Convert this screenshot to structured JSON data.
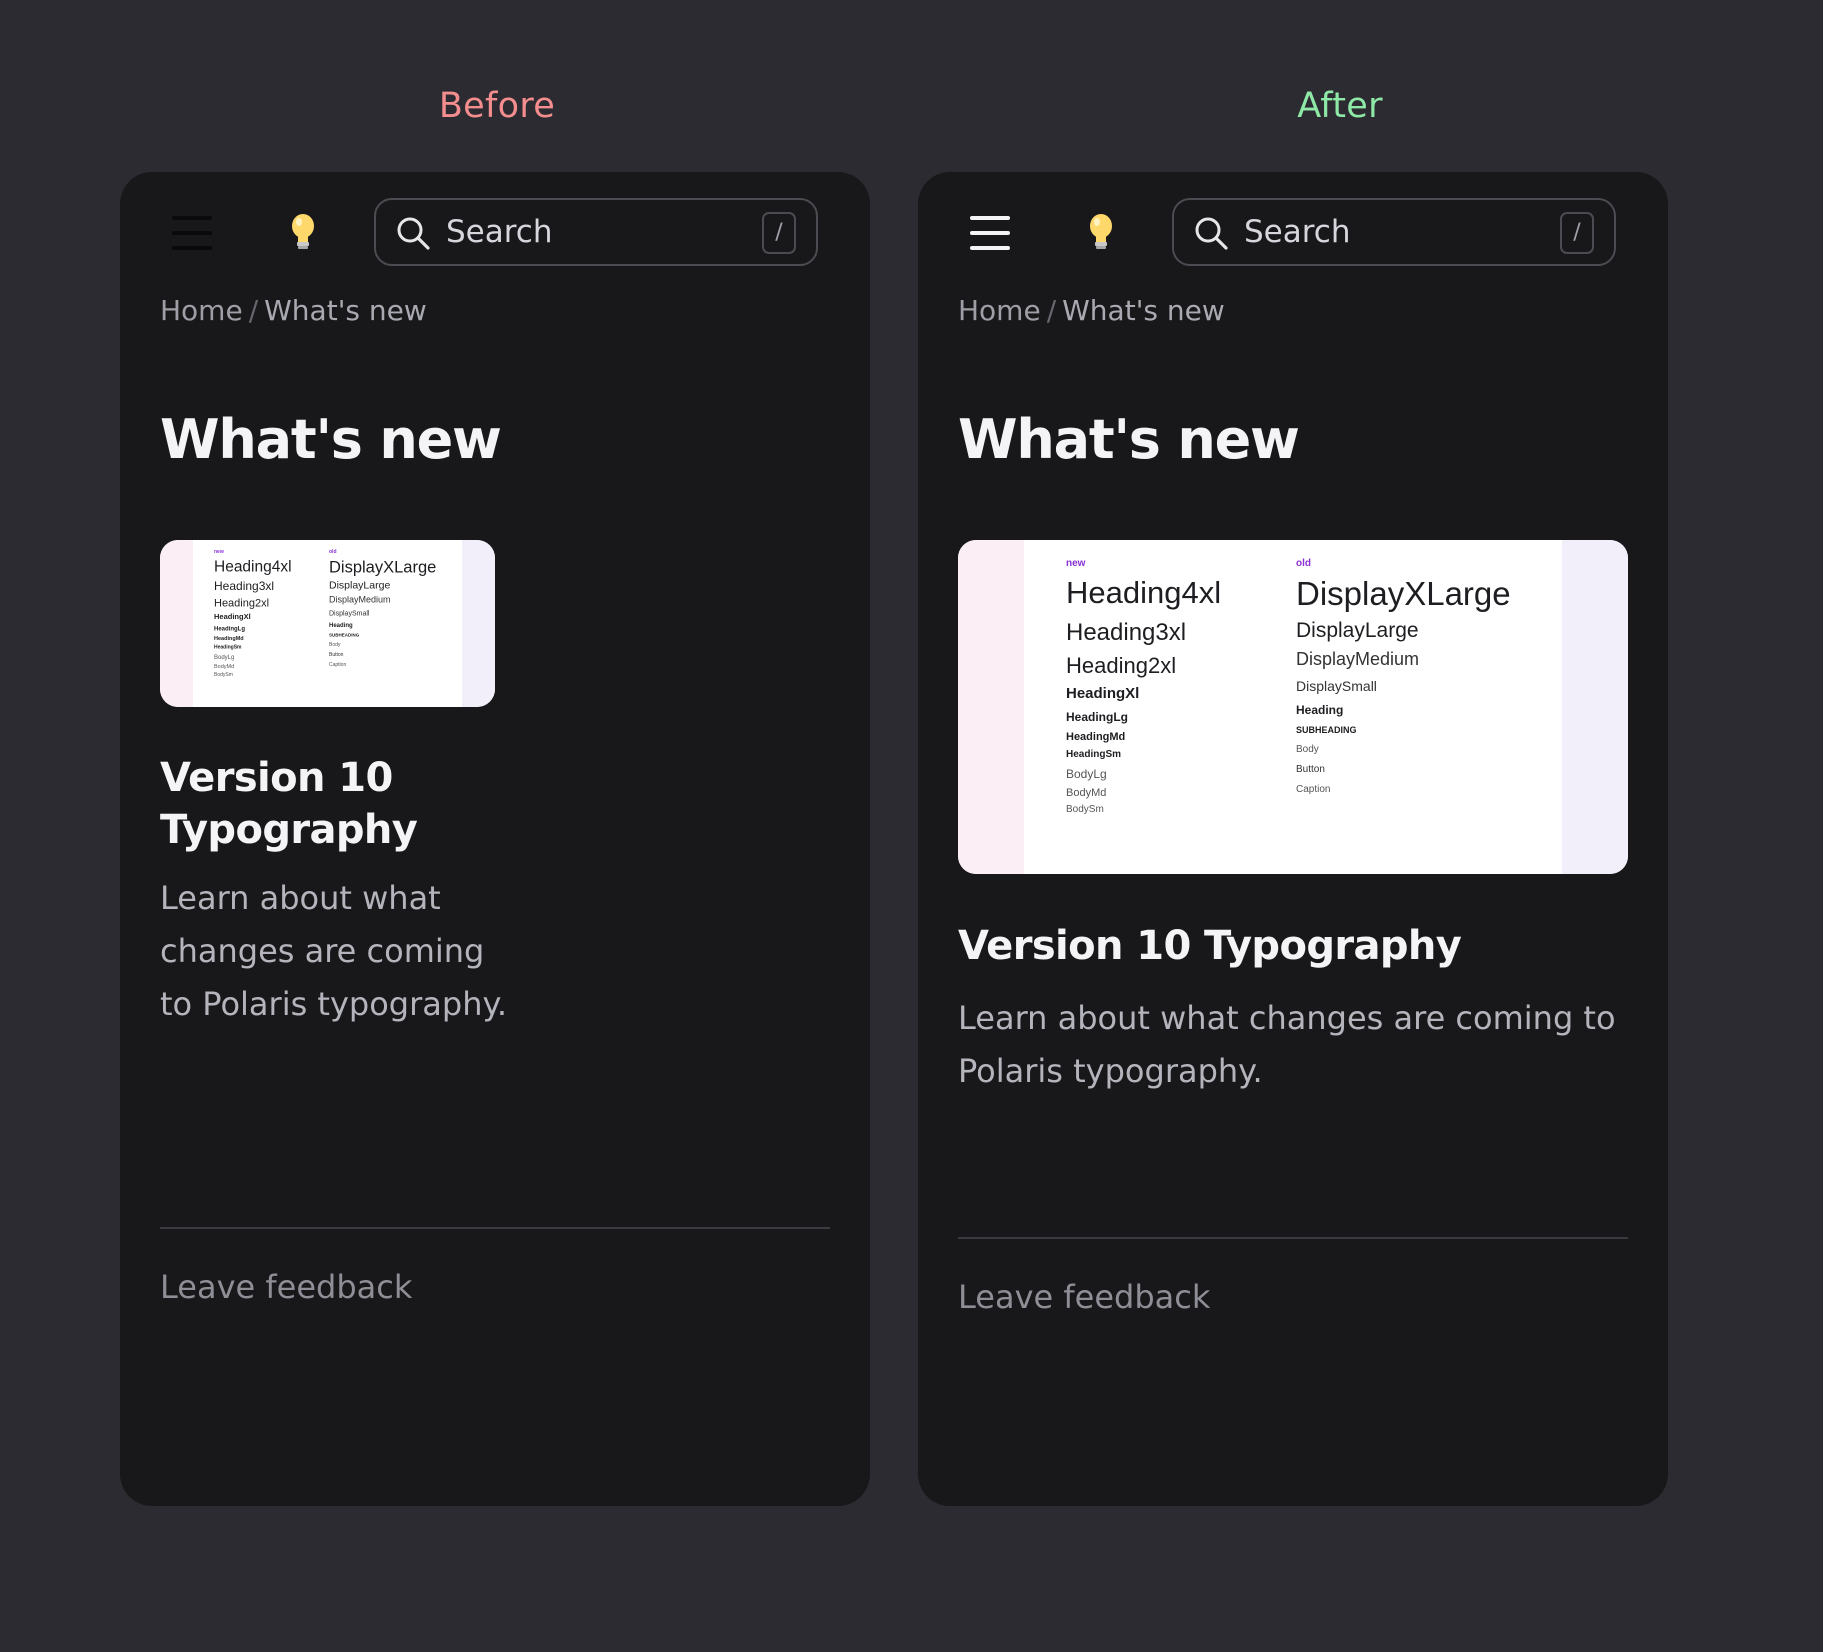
{
  "labels": {
    "before": "Before",
    "after": "After"
  },
  "colors": {
    "before": "#f48e8e",
    "after": "#8ee8a6",
    "panel_bg": "#18181b",
    "page_bg": "#2c2b31",
    "tag_purple": "#8b30d6"
  },
  "panels": {
    "before": {
      "search": {
        "value": "Search",
        "shortcut": "/"
      },
      "breadcrumb": {
        "home": "Home",
        "sep": "/",
        "current": "What's new"
      },
      "page_title": "What's new",
      "card": {
        "title": "Version 10 Typography",
        "description": "Learn about what changes are coming to Polaris typography."
      },
      "feedback": "Leave feedback"
    },
    "after": {
      "search": {
        "value": "Search",
        "shortcut": "/"
      },
      "breadcrumb": {
        "home": "Home",
        "sep": "/",
        "current": "What's new"
      },
      "page_title": "What's new",
      "card": {
        "title": "Version 10 Typography",
        "description": "Learn about what changes are coming to Polaris typography."
      },
      "feedback": "Leave feedback"
    }
  },
  "thumbnail": {
    "new_tag": "new",
    "old_tag": "old",
    "new_items": [
      "Heading4xl",
      "Heading3xl",
      "Heading2xl",
      "HeadingXl",
      "HeadingLg",
      "HeadingMd",
      "HeadingSm",
      "BodyLg",
      "BodyMd",
      "BodySm"
    ],
    "old_items": [
      "DisplayXLarge",
      "DisplayLarge",
      "DisplayMedium",
      "DisplaySmall",
      "Heading",
      "SUBHEADING",
      "Body",
      "Button",
      "Caption"
    ]
  },
  "icons": {
    "menu": "hamburger-icon",
    "theme": "lightbulb-icon",
    "search": "search-icon"
  }
}
